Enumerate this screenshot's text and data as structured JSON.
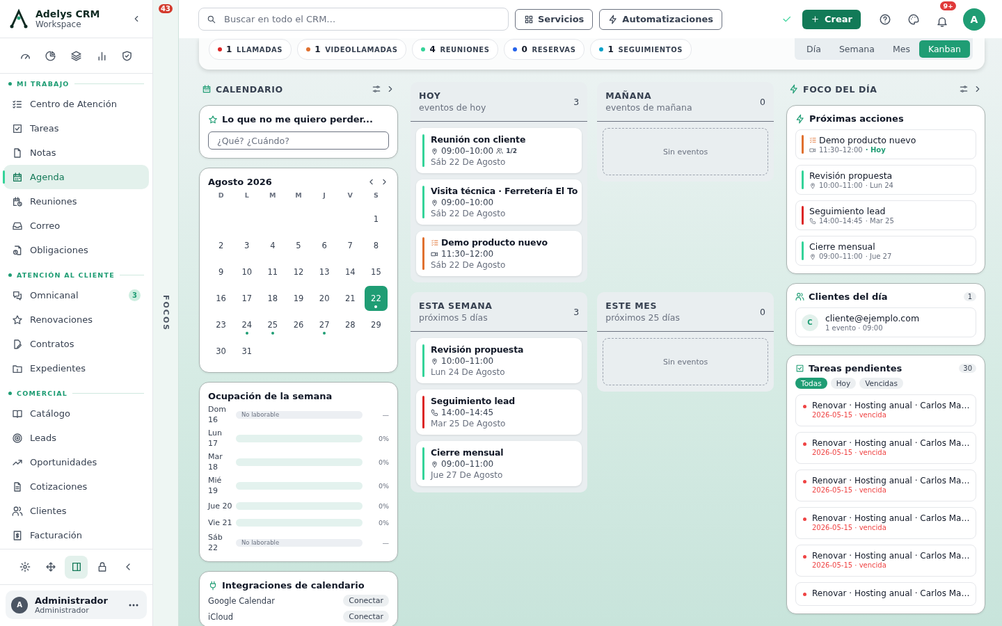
{
  "sidebar": {
    "brand": "Adelys CRM",
    "subtitle": "Workspace",
    "sections": [
      {
        "title": "MI TRABAJO",
        "items": [
          {
            "label": "Centro de Atención",
            "selected": false
          },
          {
            "label": "Tareas",
            "selected": false
          },
          {
            "label": "Notas",
            "selected": false
          },
          {
            "label": "Agenda",
            "selected": true
          },
          {
            "label": "Reuniones",
            "selected": false
          },
          {
            "label": "Correo",
            "selected": false
          },
          {
            "label": "Obligaciones",
            "selected": false
          }
        ]
      },
      {
        "title": "ATENCIÓN AL CLIENTE",
        "items": [
          {
            "label": "Omnicanal",
            "selected": false,
            "badge": "3"
          },
          {
            "label": "Renovaciones",
            "selected": false
          },
          {
            "label": "Contratos",
            "selected": false
          },
          {
            "label": "Expedientes",
            "selected": false
          }
        ]
      },
      {
        "title": "COMERCIAL",
        "items": [
          {
            "label": "Catálogo",
            "selected": false
          },
          {
            "label": "Leads",
            "selected": false
          },
          {
            "label": "Oportunidades",
            "selected": false
          },
          {
            "label": "Cotizaciones",
            "selected": false
          },
          {
            "label": "Clientes",
            "selected": false
          },
          {
            "label": "Facturación",
            "selected": false
          }
        ]
      }
    ],
    "tools": [
      {
        "selected": false
      },
      {
        "selected": false
      },
      {
        "selected": true
      },
      {
        "selected": false
      },
      {
        "selected": false
      }
    ],
    "user": {
      "initial": "A",
      "name": "Administrador",
      "role": "Administrador"
    }
  },
  "focos_rail": {
    "badge": "43",
    "label": "FOCOS"
  },
  "topbar": {
    "search": {
      "placeholder": "Buscar en todo el CRM…"
    },
    "buttons": [
      "Servicios",
      "Automatizaciones"
    ],
    "create": "Crear",
    "notifications": "9+",
    "avatar": "A"
  },
  "summary": {
    "chips": [
      {
        "count": "1",
        "label": "LLAMADAS",
        "color": "#dc2626"
      },
      {
        "count": "1",
        "label": "VIDEOLLAMADAS",
        "color": "#e0702f"
      },
      {
        "count": "4",
        "label": "REUNIONES",
        "color": "#34d399"
      },
      {
        "count": "0",
        "label": "RESERVAS",
        "color": "#2563eb"
      },
      {
        "count": "1",
        "label": "SEGUIMIENTOS",
        "color": "#06a0c8"
      }
    ],
    "views": [
      {
        "label": "Día",
        "selected": false
      },
      {
        "label": "Semana",
        "selected": false
      },
      {
        "label": "Mes",
        "selected": false
      },
      {
        "label": "Kanban",
        "selected": true
      }
    ]
  },
  "calendar_panel": {
    "title": "CALENDARIO",
    "quick_add": {
      "title": "Lo que no me quiero perder...",
      "placeholder": "¿Qué? ¿Cuándo?"
    },
    "month": {
      "title": "Agosto 2026",
      "weekdays": [
        "D",
        "L",
        "M",
        "M",
        "J",
        "V",
        "S"
      ],
      "weeks": [
        [
          {
            "day": "1",
            "selected": false,
            "has_events": false
          }
        ],
        [
          {
            "day": "2",
            "selected": false,
            "has_events": false
          },
          {
            "day": "3",
            "selected": false,
            "has_events": false
          },
          {
            "day": "4",
            "selected": false,
            "has_events": false
          },
          {
            "day": "5",
            "selected": false,
            "has_events": false
          },
          {
            "day": "6",
            "selected": false,
            "has_events": false
          },
          {
            "day": "7",
            "selected": false,
            "has_events": false
          },
          {
            "day": "8",
            "selected": false,
            "has_events": false
          }
        ],
        [
          {
            "day": "9",
            "selected": false,
            "has_events": false
          },
          {
            "day": "10",
            "selected": false,
            "has_events": false
          },
          {
            "day": "11",
            "selected": false,
            "has_events": false
          },
          {
            "day": "12",
            "selected": false,
            "has_events": false
          },
          {
            "day": "13",
            "selected": false,
            "has_events": false
          },
          {
            "day": "14",
            "selected": false,
            "has_events": false
          },
          {
            "day": "15",
            "selected": false,
            "has_events": false
          }
        ],
        [
          {
            "day": "16",
            "selected": false,
            "has_events": false
          },
          {
            "day": "17",
            "selected": false,
            "has_events": false
          },
          {
            "day": "18",
            "selected": false,
            "has_events": false
          },
          {
            "day": "19",
            "selected": false,
            "has_events": false
          },
          {
            "day": "20",
            "selected": false,
            "has_events": false
          },
          {
            "day": "21",
            "selected": false,
            "has_events": false
          },
          {
            "day": "22",
            "selected": true,
            "has_events": true
          }
        ],
        [
          {
            "day": "23",
            "selected": false,
            "has_events": false
          },
          {
            "day": "24",
            "selected": false,
            "has_events": true
          },
          {
            "day": "25",
            "selected": false,
            "has_events": true
          },
          {
            "day": "26",
            "selected": false,
            "has_events": false
          },
          {
            "day": "27",
            "selected": false,
            "has_events": true
          },
          {
            "day": "28",
            "selected": false,
            "has_events": false
          },
          {
            "day": "29",
            "selected": false,
            "has_events": false
          }
        ],
        [
          {
            "day": "30",
            "selected": false,
            "has_events": false
          },
          {
            "day": "31",
            "selected": false,
            "has_events": false
          }
        ]
      ]
    },
    "occupancy": {
      "title": "Ocupación de la semana",
      "rows": [
        {
          "day": "Dom 16",
          "kind": "off",
          "note": "No laborable",
          "reading": "—"
        },
        {
          "day": "Lun 17",
          "kind": "work",
          "level": 0,
          "reading": "0%"
        },
        {
          "day": "Mar 18",
          "kind": "work",
          "level": 0,
          "reading": "0%"
        },
        {
          "day": "Mié 19",
          "kind": "work",
          "level": 0,
          "reading": "0%"
        },
        {
          "day": "Jue 20",
          "kind": "work",
          "level": 0,
          "reading": "0%"
        },
        {
          "day": "Vie 21",
          "kind": "work",
          "level": 0,
          "reading": "0%"
        },
        {
          "day": "Sáb 22",
          "kind": "off",
          "note": "No laborable",
          "reading": "—"
        }
      ]
    },
    "integrations": {
      "title": "Integraciones de calendario",
      "items": [
        {
          "name": "Google Calendar",
          "action": "Conectar"
        },
        {
          "name": "iCloud",
          "action": "Conectar"
        }
      ]
    }
  },
  "kanban": [
    {
      "title": "HOY",
      "subtitle": "eventos de hoy",
      "count": "3",
      "events": [
        {
          "title": "Reunión con cliente",
          "kind": "place",
          "time": "09:00–10:00",
          "attendees": "1/2",
          "date": "Sáb 22 De Agosto",
          "color": "#34d399",
          "task": false
        },
        {
          "title": "Visita técnica · Ferretería El To",
          "kind": "place",
          "time": "09:00–10:00",
          "date": "Sáb 22 De Agosto",
          "color": "#34d399",
          "task": false
        },
        {
          "title": "Demo producto nuevo",
          "kind": "video",
          "time": "11:30–12:00",
          "date": "Sáb 22 De Agosto",
          "color": "#e0702f",
          "task": true
        }
      ]
    },
    {
      "title": "MAÑANA",
      "subtitle": "eventos de mañana",
      "count": "0",
      "empty_text": "Sin eventos"
    },
    {
      "title": "ESTA SEMANA",
      "subtitle": "próximos 5 días",
      "count": "3",
      "events": [
        {
          "title": "Revisión propuesta",
          "kind": "place",
          "time": "10:00–11:00",
          "date": "Lun 24 De Agosto",
          "color": "#34d399",
          "task": false
        },
        {
          "title": "Seguimiento lead",
          "kind": "phone",
          "time": "14:00–14:45",
          "date": "Mar 25 De Agosto",
          "color": "#dc2626",
          "task": false
        },
        {
          "title": "Cierre mensual",
          "kind": "place",
          "time": "09:00–11:00",
          "date": "Jue 27 De Agosto",
          "color": "#34d399",
          "task": false
        }
      ]
    },
    {
      "title": "ESTE MES",
      "subtitle": "próximos 25 días",
      "count": "0",
      "empty_text": "Sin eventos"
    }
  ],
  "focus_panel": {
    "title": "FOCO DEL DÍA",
    "next_actions": {
      "title": "Próximas acciones",
      "items": [
        {
          "title": "Demo producto nuevo",
          "kind": "video",
          "time": "11:30–12:00",
          "day": "· Hoy",
          "today": true,
          "color": "#e0702f",
          "task": true
        },
        {
          "title": "Revisión propuesta",
          "kind": "place",
          "time": "10:00–11:00",
          "day": "· Lun 24",
          "today": false,
          "color": "#34d399",
          "task": false
        },
        {
          "title": "Seguimiento lead",
          "kind": "phone",
          "time": "14:00–14:45",
          "day": "· Mar 25",
          "today": false,
          "color": "#dc2626",
          "task": false
        },
        {
          "title": "Cierre mensual",
          "kind": "place",
          "time": "09:00–11:00",
          "day": "· Jue 27",
          "today": false,
          "color": "#34d399",
          "task": false
        }
      ]
    },
    "clients": {
      "title": "Clientes del día",
      "count": "1",
      "items": [
        {
          "initial": "C",
          "email": "cliente@ejemplo.com",
          "detail": "1 evento · 09:00"
        }
      ]
    },
    "tasks": {
      "title": "Tareas pendientes",
      "count": "30",
      "filters": [
        {
          "label": "Todas",
          "selected": true
        },
        {
          "label": "Hoy",
          "selected": false
        },
        {
          "label": "Vencidas",
          "selected": false
        }
      ],
      "items": [
        {
          "title": "Renovar · Hosting anual · Carlos Ma…",
          "due": "2026-05-15 · vencida",
          "overdue": true
        },
        {
          "title": "Renovar · Hosting anual · Carlos Ma…",
          "due": "2026-05-15 · vencida",
          "overdue": true
        },
        {
          "title": "Renovar · Hosting anual · Carlos Ma…",
          "due": "2026-05-15 · vencida",
          "overdue": true
        },
        {
          "title": "Renovar · Hosting anual · Carlos Ma…",
          "due": "2026-05-15 · vencida",
          "overdue": true
        },
        {
          "title": "Renovar · Hosting anual · Carlos Ma…",
          "due": "2026-05-15 · vencida",
          "overdue": true
        },
        {
          "title": "Renovar · Hosting anual · Carlos Ma…",
          "overdue": true
        }
      ]
    }
  }
}
